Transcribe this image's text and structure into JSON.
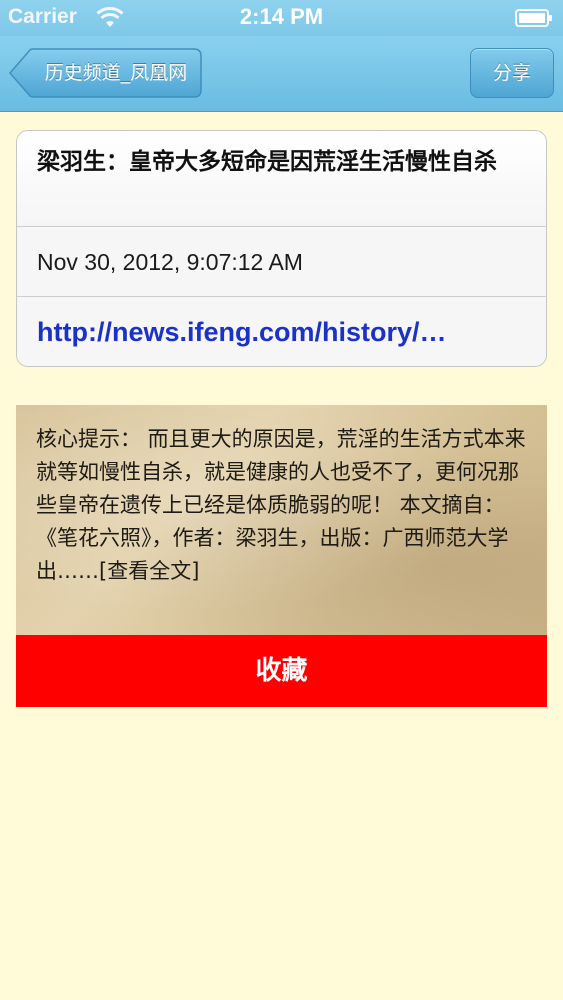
{
  "status_bar": {
    "carrier": "Carrier",
    "time": "2:14 PM"
  },
  "nav_bar": {
    "back_label": "历史频道_凤凰网",
    "share_label": "分享"
  },
  "article": {
    "title": "梁羽生：皇帝大多短命是因荒淫生活慢性自杀",
    "date": "Nov 30, 2012, 9:07:12 AM",
    "link": "http://news.ifeng.com/history/…"
  },
  "summary": {
    "text": "核心提示： 而且更大的原因是，荒淫的生活方式本来就等如慢性自杀，就是健康的人也受不了，更何况那些皇帝在遗传上已经是体质脆弱的呢！ 本文摘自：《笔花六照》，作者：梁羽生，出版：广西师范大学出……[查看全文]"
  },
  "favorite": {
    "label": "收藏"
  },
  "colors": {
    "nav_bar": "#7ec8e8",
    "background": "#fffbd8",
    "link": "#1a33c6",
    "favorite_button": "#ff0000"
  },
  "icons": [
    "wifi-icon",
    "battery-icon",
    "back-chevron-icon"
  ]
}
